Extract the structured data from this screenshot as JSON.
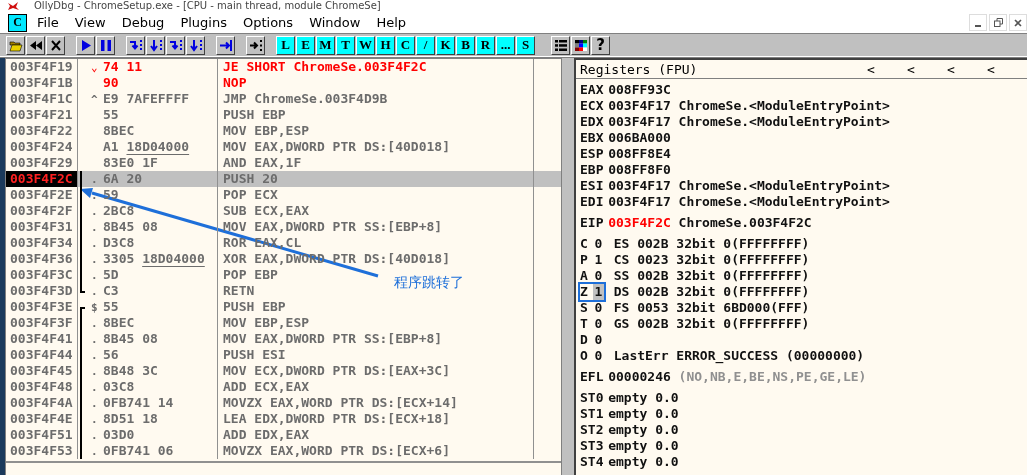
{
  "window": {
    "title": "OllyDbg - ChromeSetup.exe - [CPU - main thread, module ChromeSe]"
  },
  "menu": [
    "File",
    "View",
    "Debug",
    "Plugins",
    "Options",
    "Window",
    "Help"
  ],
  "menu_icon": "C",
  "toolbar": {
    "letters": [
      "L",
      "E",
      "M",
      "T",
      "W",
      "H",
      "C",
      "/",
      "K",
      "B",
      "R",
      "...",
      "S"
    ],
    "help": "?"
  },
  "disassembly": [
    {
      "address": "003F4F19",
      "mark": "⌄",
      "hex": "74 11",
      "command": "JE SHORT ChromeSe.003F4F2C",
      "modified": true,
      "selected": false,
      "in_block": false,
      "block_start": false,
      "block_end": false
    },
    {
      "address": "003F4F1B",
      "hex": "90",
      "command": "NOP",
      "modified": true,
      "selected": false,
      "in_block": false,
      "block_start": false,
      "block_end": false
    },
    {
      "address": "003F4F1C",
      "mark": "^",
      "hex": "E9 7AFEFFFF",
      "command": "JMP ChromeSe.003F4D9B",
      "modified": false,
      "selected": false,
      "in_block": false,
      "block_start": false,
      "block_end": false
    },
    {
      "address": "003F4F21",
      "hex": "55",
      "command": "PUSH EBP",
      "modified": false,
      "selected": false,
      "in_block": false,
      "block_start": false,
      "block_end": false
    },
    {
      "address": "003F4F22",
      "hex": "8BEC",
      "command": "MOV EBP,ESP",
      "modified": false,
      "selected": false,
      "in_block": false,
      "block_start": false,
      "block_end": false
    },
    {
      "address": "003F4F24",
      "hex": "A1",
      "hex_ref": "18D04000",
      "command": "MOV EAX,DWORD PTR DS:[40D018]",
      "modified": false,
      "selected": false,
      "in_block": false,
      "block_start": false,
      "block_end": false
    },
    {
      "address": "003F4F29",
      "hex": "83E0 1F",
      "command": "AND EAX,1F",
      "modified": false,
      "selected": false,
      "in_block": false,
      "block_start": false,
      "block_end": false
    },
    {
      "address": "003F4F2C",
      "mark": ".",
      "hex": "6A 20",
      "command": "PUSH 20",
      "modified": false,
      "selected": true,
      "in_block": true,
      "block_start": false,
      "block_end": false
    },
    {
      "address": "003F4F2E",
      "mark": ".",
      "hex": "59",
      "command": "POP ECX",
      "modified": false,
      "selected": false,
      "in_block": true,
      "block_start": false,
      "block_end": false
    },
    {
      "address": "003F4F2F",
      "mark": ".",
      "hex": "2BC8",
      "command": "SUB ECX,EAX",
      "modified": false,
      "selected": false,
      "in_block": true,
      "block_start": false,
      "block_end": false
    },
    {
      "address": "003F4F31",
      "mark": ".",
      "hex": "8B45 08",
      "command": "MOV EAX,DWORD PTR SS:[EBP+8]",
      "modified": false,
      "selected": false,
      "in_block": true,
      "block_start": false,
      "block_end": false
    },
    {
      "address": "003F4F34",
      "mark": ".",
      "hex": "D3C8",
      "command": "ROR EAX,CL",
      "modified": false,
      "selected": false,
      "in_block": true,
      "block_start": false,
      "block_end": false
    },
    {
      "address": "003F4F36",
      "mark": ".",
      "hex": "3305",
      "hex_ref": "18D04000",
      "command": "XOR EAX,DWORD PTR DS:[40D018]",
      "modified": false,
      "selected": false,
      "in_block": true,
      "block_start": false,
      "block_end": false
    },
    {
      "address": "003F4F3C",
      "mark": ".",
      "hex": "5D",
      "command": "POP EBP",
      "modified": false,
      "selected": false,
      "in_block": true,
      "block_start": false,
      "block_end": false
    },
    {
      "address": "003F4F3D",
      "mark": ".",
      "hex": "C3",
      "command": "RETN",
      "modified": false,
      "selected": false,
      "in_block": true,
      "block_start": false,
      "block_end": true
    },
    {
      "address": "003F4F3E",
      "mark": "$",
      "hex": "55",
      "command": "PUSH EBP",
      "modified": false,
      "selected": false,
      "in_block": true,
      "block_start": true,
      "block_end": false
    },
    {
      "address": "003F4F3F",
      "mark": ".",
      "hex": "8BEC",
      "command": "MOV EBP,ESP",
      "modified": false,
      "selected": false,
      "in_block": true,
      "block_start": false,
      "block_end": false
    },
    {
      "address": "003F4F41",
      "mark": ".",
      "hex": "8B45 08",
      "command": "MOV EAX,DWORD PTR SS:[EBP+8]",
      "modified": false,
      "selected": false,
      "in_block": true,
      "block_start": false,
      "block_end": false
    },
    {
      "address": "003F4F44",
      "mark": ".",
      "hex": "56",
      "command": "PUSH ESI",
      "modified": false,
      "selected": false,
      "in_block": true,
      "block_start": false,
      "block_end": false
    },
    {
      "address": "003F4F45",
      "mark": ".",
      "hex": "8B48 3C",
      "command": "MOV ECX,DWORD PTR DS:[EAX+3C]",
      "modified": false,
      "selected": false,
      "in_block": true,
      "block_start": false,
      "block_end": false
    },
    {
      "address": "003F4F48",
      "mark": ".",
      "hex": "03C8",
      "command": "ADD ECX,EAX",
      "modified": false,
      "selected": false,
      "in_block": true,
      "block_start": false,
      "block_end": false
    },
    {
      "address": "003F4F4A",
      "mark": ".",
      "hex": "0FB741 14",
      "command": "MOVZX EAX,WORD PTR DS:[ECX+14]",
      "modified": false,
      "selected": false,
      "in_block": true,
      "block_start": false,
      "block_end": false
    },
    {
      "address": "003F4F4E",
      "mark": ".",
      "hex": "8D51 18",
      "command": "LEA EDX,DWORD PTR DS:[ECX+18]",
      "modified": false,
      "selected": false,
      "in_block": true,
      "block_start": false,
      "block_end": false
    },
    {
      "address": "003F4F51",
      "mark": ".",
      "hex": "03D0",
      "command": "ADD EDX,EAX",
      "modified": false,
      "selected": false,
      "in_block": true,
      "block_start": false,
      "block_end": false
    },
    {
      "address": "003F4F53",
      "mark": ".",
      "hex": "0FB741 06",
      "command": "MOVZX EAX,WORD PTR DS:[ECX+6]",
      "modified": false,
      "selected": false,
      "in_block": true,
      "block_start": false,
      "block_end": false
    }
  ],
  "registers": {
    "title": "Registers (FPU)",
    "arrows": [
      "<",
      "<",
      "<",
      "<"
    ],
    "groups": [
      {
        "rows": [
          {
            "kind": "register",
            "name": "EAX",
            "value": "008FF93C",
            "changed": false
          },
          {
            "kind": "register",
            "name": "ECX",
            "value": "003F4F17",
            "detail": "ChromeSe.<ModuleEntryPoint>",
            "changed": false
          },
          {
            "kind": "register",
            "name": "EDX",
            "value": "003F4F17",
            "detail": "ChromeSe.<ModuleEntryPoint>",
            "changed": false
          },
          {
            "kind": "register",
            "name": "EBX",
            "value": "006BA000",
            "changed": false
          },
          {
            "kind": "register",
            "name": "ESP",
            "value": "008FF8E4",
            "changed": false
          },
          {
            "kind": "register",
            "name": "EBP",
            "value": "008FF8F0",
            "changed": false
          },
          {
            "kind": "register",
            "name": "ESI",
            "value": "003F4F17",
            "detail": "ChromeSe.<ModuleEntryPoint>",
            "changed": false
          },
          {
            "kind": "register",
            "name": "EDI",
            "value": "003F4F17",
            "detail": "ChromeSe.<ModuleEntryPoint>",
            "changed": false
          }
        ]
      },
      {
        "rows": [
          {
            "kind": "register",
            "name": "EIP",
            "value": "003F4F2C",
            "detail": "ChromeSe.003F4F2C",
            "changed": true
          }
        ]
      },
      {
        "rows": [
          {
            "kind": "flag",
            "name": "C",
            "value": "0",
            "detail": "ES 002B 32bit 0(FFFFFFFF)",
            "changed": false
          },
          {
            "kind": "flag",
            "name": "P",
            "value": "1",
            "detail": "CS 0023 32bit 0(FFFFFFFF)",
            "changed": false
          },
          {
            "kind": "flag",
            "name": "A",
            "value": "0",
            "detail": "SS 002B 32bit 0(FFFFFFFF)",
            "changed": false
          },
          {
            "kind": "flag",
            "name": "Z",
            "value": "1",
            "detail": "DS 002B 32bit 0(FFFFFFFF)",
            "changed": true,
            "annotated": true
          },
          {
            "kind": "flag",
            "name": "S",
            "value": "0",
            "detail": "FS 0053 32bit 6BD000(FFF)",
            "changed": false
          },
          {
            "kind": "flag",
            "name": "T",
            "value": "0",
            "detail": "GS 002B 32bit 0(FFFFFFFF)",
            "changed": false
          },
          {
            "kind": "flag",
            "name": "D",
            "value": "0",
            "changed": false
          },
          {
            "kind": "flag",
            "name": "O",
            "value": "0",
            "detail": "LastErr ERROR_SUCCESS (00000000)",
            "changed": false
          }
        ]
      },
      {
        "rows": [
          {
            "kind": "efl",
            "name": "EFL",
            "value": "00000246",
            "detail": "(NO,NB,E,BE,NS,PE,GE,LE)",
            "changed": false
          }
        ]
      },
      {
        "rows": [
          {
            "kind": "fpu",
            "name": "ST0",
            "value": "empty",
            "detail": "0.0",
            "changed": false
          },
          {
            "kind": "fpu",
            "name": "ST1",
            "value": "empty",
            "detail": "0.0",
            "changed": false
          },
          {
            "kind": "fpu",
            "name": "ST2",
            "value": "empty",
            "detail": "0.0",
            "changed": false
          },
          {
            "kind": "fpu",
            "name": "ST3",
            "value": "empty",
            "detail": "0.0",
            "changed": false
          },
          {
            "kind": "fpu",
            "name": "ST4",
            "value": "empty",
            "detail": "0.0",
            "changed": false
          }
        ]
      }
    ]
  },
  "annotation": {
    "text": "程序跳转了"
  }
}
